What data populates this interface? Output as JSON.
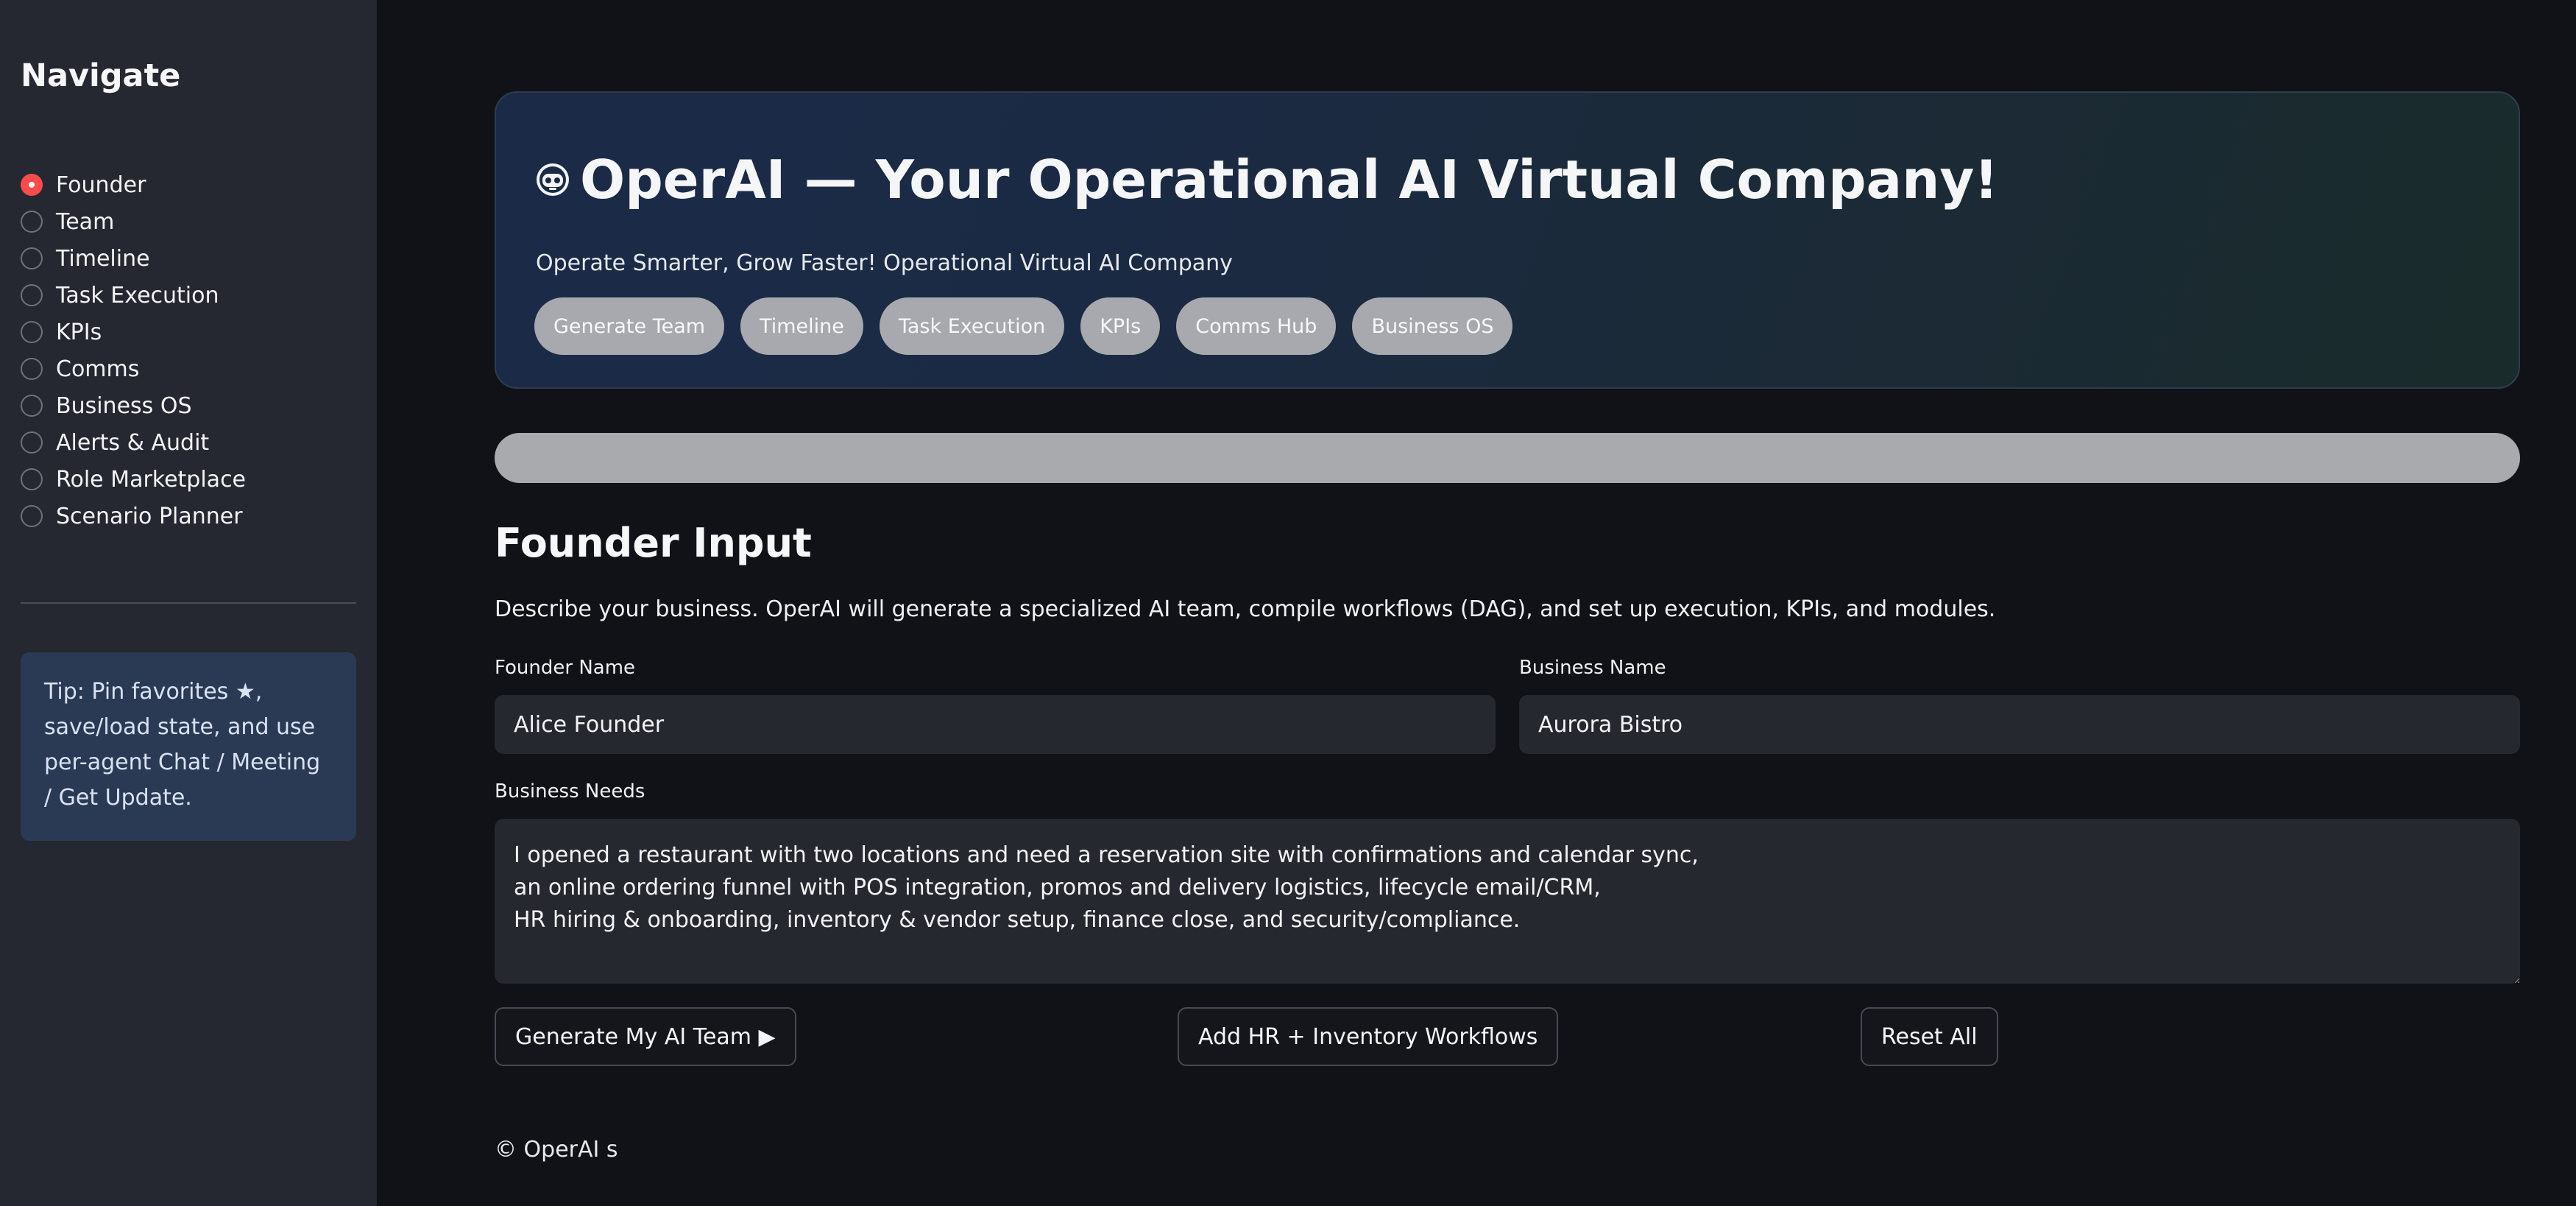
{
  "sidebar": {
    "title": "Navigate",
    "items": [
      {
        "label": "Founder",
        "selected": true
      },
      {
        "label": "Team",
        "selected": false
      },
      {
        "label": "Timeline",
        "selected": false
      },
      {
        "label": "Task Execution",
        "selected": false
      },
      {
        "label": "KPIs",
        "selected": false
      },
      {
        "label": "Comms",
        "selected": false
      },
      {
        "label": "Business OS",
        "selected": false
      },
      {
        "label": "Alerts & Audit",
        "selected": false
      },
      {
        "label": "Role Marketplace",
        "selected": false
      },
      {
        "label": "Scenario Planner",
        "selected": false
      }
    ],
    "tip": "Tip: Pin favorites ★, save/load state, and use per-agent Chat / Meeting / Get Update."
  },
  "hero": {
    "title": "OperAI — Your Operational AI Virtual Company!",
    "icon": "robot-icon",
    "subtitle": "Operate Smarter, Grow Faster! Operational Virtual AI Company",
    "pills": [
      "Generate Team",
      "Timeline",
      "Task Execution",
      "KPIs",
      "Comms Hub",
      "Business OS"
    ]
  },
  "main": {
    "section_title": "Founder Input",
    "description": "Describe your business. OperAI will generate a specialized AI team, compile workflows (DAG), and set up execution, KPIs, and modules.",
    "founder_name_label": "Founder Name",
    "founder_name_value": "Alice Founder",
    "business_name_label": "Business Name",
    "business_name_value": "Aurora Bistro",
    "business_needs_label": "Business Needs",
    "business_needs_value": "I opened a restaurant with two locations and need a reservation site with confirmations and calendar sync,\nan online ordering funnel with POS integration, promos and delivery logistics, lifecycle email/CRM,\nHR hiring & onboarding, inventory & vendor setup, finance close, and security/compliance.",
    "buttons": {
      "generate": "Generate My AI Team ▶",
      "add_workflows": "Add HR + Inventory Workflows",
      "reset": "Reset All"
    }
  },
  "footer": "© OperAI s",
  "colors": {
    "accent": "#ff4b4b",
    "background": "#101217",
    "sidebar": "#262831",
    "tip_bg": "#2b3a54",
    "pill": "#a7a9ae"
  }
}
